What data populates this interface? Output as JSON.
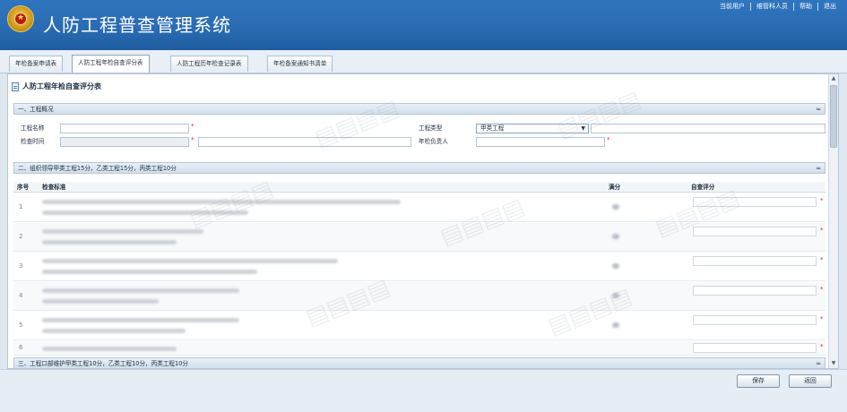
{
  "app": {
    "title": "人防工程普查管理系统"
  },
  "topnav": [
    "当前用户",
    "维管科人员",
    "帮助",
    "退出"
  ],
  "tabs": [
    "年检备案申请表",
    "人防工程年检自查评分表",
    "人防工程历年检查记录表",
    "年检备案通知书清单"
  ],
  "active_tab_index": 1,
  "form": {
    "title": "人防工程年检自查评分表",
    "section1": {
      "title": "一、工程概况",
      "fields": {
        "name_label": "工程名称",
        "type_label": "工程类型",
        "type_value": "甲类工程",
        "date_label": "检查时间",
        "person_label": "年检负责人"
      }
    },
    "section2": {
      "title": "二、组织领导甲类工程15分，乙类工程15分，丙类工程10分",
      "columns": [
        "序号",
        "检查标准",
        "满分",
        "自查评分"
      ],
      "row_numbers": [
        "1",
        "2",
        "3",
        "4",
        "5",
        "6"
      ]
    },
    "section3": {
      "title": "三、工程口部维护甲类工程10分，乙类工程10分，丙类工程10分"
    },
    "collapse_glyph": "≈"
  },
  "buttons": {
    "save": "保存",
    "back": "返回"
  },
  "colors": {
    "header": "#2a6cb3",
    "required": "#d42525",
    "section_bar": "#dfe8f1"
  }
}
